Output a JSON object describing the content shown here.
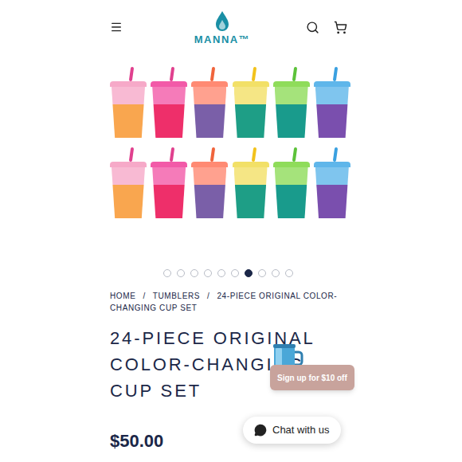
{
  "header": {
    "logo": "MANNA™"
  },
  "product_image": {
    "cups": [
      {
        "color": "#f6a9c8",
        "bottom_color": "#f9a64f",
        "straw": "#e0408e"
      },
      {
        "color": "#f25aa8",
        "bottom_color": "#ee2f6a",
        "straw": "#e0408e"
      },
      {
        "color": "#ff8a73",
        "bottom_color": "#7a5fa8",
        "straw": "#f0643c"
      },
      {
        "color": "#f2e067",
        "bottom_color": "#1e9e86",
        "straw": "#f2c21c"
      },
      {
        "color": "#8fdc5a",
        "bottom_color": "#199b8c",
        "straw": "#5cc23a"
      },
      {
        "color": "#5fb6ea",
        "bottom_color": "#7a4fae",
        "straw": "#3aa0e0"
      },
      {
        "color": "#f6a9c8",
        "bottom_color": "#f9a64f",
        "straw": "#e0408e"
      },
      {
        "color": "#f25aa8",
        "bottom_color": "#ee2f6a",
        "straw": "#e0408e"
      },
      {
        "color": "#ff8a73",
        "bottom_color": "#7a5fa8",
        "straw": "#f0643c"
      },
      {
        "color": "#f2e067",
        "bottom_color": "#1e9e86",
        "straw": "#f2c21c"
      },
      {
        "color": "#8fdc5a",
        "bottom_color": "#199b8c",
        "straw": "#5cc23a"
      },
      {
        "color": "#5fb6ea",
        "bottom_color": "#7a4fae",
        "straw": "#3aa0e0"
      }
    ]
  },
  "carousel_dots": [
    {
      "selected": false
    },
    {
      "selected": false
    },
    {
      "selected": false
    },
    {
      "selected": false
    },
    {
      "selected": false
    },
    {
      "selected": false
    },
    {
      "selected": true
    },
    {
      "selected": false
    },
    {
      "selected": false
    },
    {
      "selected": false
    }
  ],
  "breadcrumb": [
    "HOME",
    "/",
    "TUMBLERS",
    "/",
    "24-PIECE ORIGINAL COLOR-CHANGING CUP SET"
  ],
  "title_lines": [
    "24-PIECE ORIGINAL",
    "COLOR-CHANGING",
    "CUP SET"
  ],
  "price": "$50.00",
  "signup_button": "Sign up for $10 off",
  "chat_button": "Chat with us"
}
